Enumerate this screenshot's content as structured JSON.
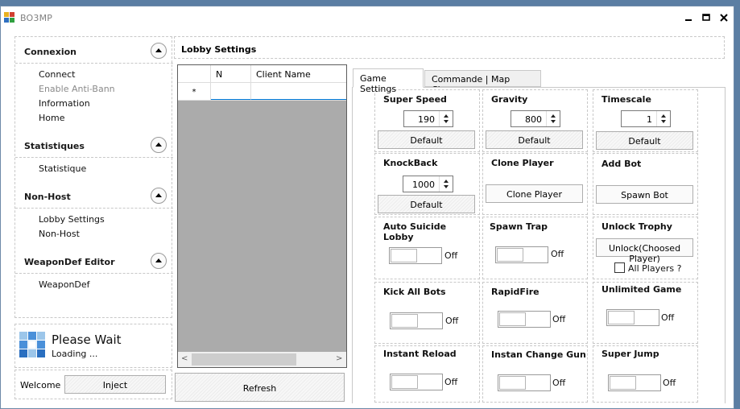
{
  "window": {
    "title": "BO3MP"
  },
  "sidebar": {
    "sections": [
      {
        "title": "Connexion",
        "items": [
          {
            "label": "Connect",
            "disabled": false
          },
          {
            "label": "Enable Anti-Bann",
            "disabled": true
          },
          {
            "label": "Information",
            "disabled": false
          },
          {
            "label": "Home",
            "disabled": false
          }
        ]
      },
      {
        "title": "Statistiques",
        "items": [
          {
            "label": "Statistique",
            "disabled": false
          }
        ]
      },
      {
        "title": "Non-Host",
        "items": [
          {
            "label": "Lobby Settings",
            "disabled": false
          },
          {
            "label": "Non-Host",
            "disabled": false
          }
        ]
      },
      {
        "title": "WeaponDef Editor",
        "items": [
          {
            "label": "WeaponDef",
            "disabled": false
          }
        ]
      }
    ]
  },
  "loading": {
    "title": "Please Wait",
    "subtitle": "Loading ..."
  },
  "welcome": {
    "label": "Welcome :",
    "inject_label": "Inject"
  },
  "lobby": {
    "title": "Lobby Settings",
    "columns": [
      "N",
      "Client Name"
    ],
    "new_row_marker": "*",
    "refresh_label": "Refresh",
    "scroll_left": "<",
    "scroll_right": ">"
  },
  "tabs": [
    {
      "label": "Game Settings",
      "active": true
    },
    {
      "label": "Commande | Map Changer",
      "active": false
    }
  ],
  "settings": {
    "super_speed": {
      "title": "Super Speed",
      "value": "190",
      "button": "Default"
    },
    "gravity": {
      "title": "Gravity",
      "value": "800",
      "button": "Default"
    },
    "timescale": {
      "title": "Timescale",
      "value": "1",
      "button": "Default"
    },
    "knockback": {
      "title": "KnockBack",
      "value": "1000",
      "button": "Default"
    },
    "clone_player": {
      "title": "Clone Player",
      "button": "Clone Player"
    },
    "add_bot": {
      "title": "Add Bot",
      "button": "Spawn Bot"
    },
    "auto_suicide": {
      "title": "Auto Suicide Lobby",
      "state": "Off"
    },
    "spawn_trap": {
      "title": "Spawn Trap",
      "state": "Off"
    },
    "unlock_trophy": {
      "title": "Unlock Trophy",
      "button": "Unlock(Choosed Player)",
      "checkbox_label": "All Players ?",
      "checked": false
    },
    "kick_all_bots": {
      "title": "Kick All Bots",
      "state": "Off"
    },
    "rapidfire": {
      "title": "RapidFire",
      "state": "Off"
    },
    "unlimited_game": {
      "title": "Unlimited Game",
      "state": "Off"
    },
    "instant_reload": {
      "title": "Instant Reload",
      "state": "Off"
    },
    "instan_change_gun": {
      "title": "Instan Change Gun",
      "state": "Off"
    },
    "super_jump": {
      "title": "Super Jump",
      "state": "Off"
    }
  }
}
